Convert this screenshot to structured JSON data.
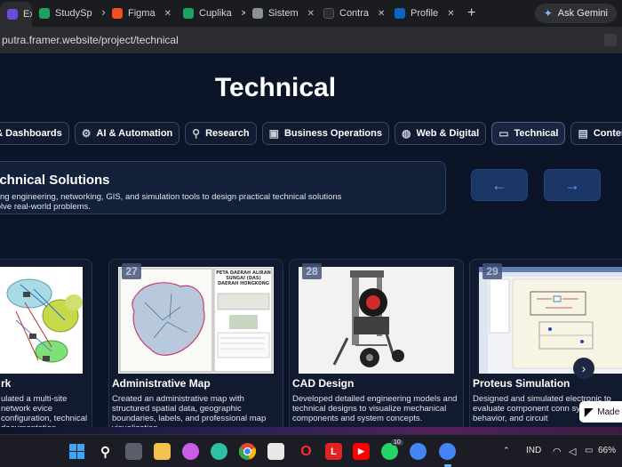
{
  "browser": {
    "tabs": [
      {
        "label": "Ex",
        "color": "#6c4ad6"
      },
      {
        "label": "StudySp",
        "color": "#1aa260"
      },
      {
        "label": "Figma",
        "color": "#f24e1e"
      },
      {
        "label": "Cuplika",
        "color": "#1aa260"
      },
      {
        "label": "Sistem",
        "color": "#8a8f98"
      },
      {
        "label": "Contra",
        "color": "#2c2d31"
      },
      {
        "label": "Profile",
        "color": "#0a66c2"
      }
    ],
    "new_tab": "+",
    "gemini_label": "Ask Gemini",
    "url": "putra.framer.website/project/technical"
  },
  "page": {
    "title": "Technical",
    "categories": [
      {
        "label": "a & Dashboards",
        "icon": "chart-icon"
      },
      {
        "label": "AI & Automation",
        "icon": "gear-icon"
      },
      {
        "label": "Research",
        "icon": "search-icon"
      },
      {
        "label": "Business Operations",
        "icon": "briefcase-icon"
      },
      {
        "label": "Web & Digital",
        "icon": "globe-icon"
      },
      {
        "label": "Technical",
        "icon": "monitor-icon",
        "active": true
      },
      {
        "label": "Content",
        "icon": "document-icon"
      }
    ],
    "solutions": {
      "title": "echnical Solutions",
      "desc_line1": "lying engineering, networking, GIS, and simulation tools to design practical technical solutions",
      "desc_line2": "solve real-world problems."
    },
    "prev_arrow": "←",
    "next_arrow": "→",
    "cards": [
      {
        "num": "",
        "title": "rk",
        "desc": "ulated a multi-site network evice configuration, technical documentation."
      },
      {
        "num": "27",
        "title": "Administrative Map",
        "desc": "Created an administrative map with structured spatial data, geographic boundaries, labels, and professional map visualization."
      },
      {
        "num": "28",
        "title": "CAD Design",
        "desc": "Developed detailed engineering models and technical designs to visualize mechanical components and system concepts."
      },
      {
        "num": "29",
        "title": "Proteus Simulation",
        "desc": "Designed and simulated electronic to evaluate component conn system behavior, and circuit"
      }
    ],
    "map_header": "PETA DAERAH ALIRAN SUNGAI (DAS) DAERAH HONGKONG",
    "carousel_next": "›",
    "made_in": "Made"
  },
  "taskbar": {
    "lang": "IND",
    "battery": "66%",
    "chrome_badge": "10"
  }
}
